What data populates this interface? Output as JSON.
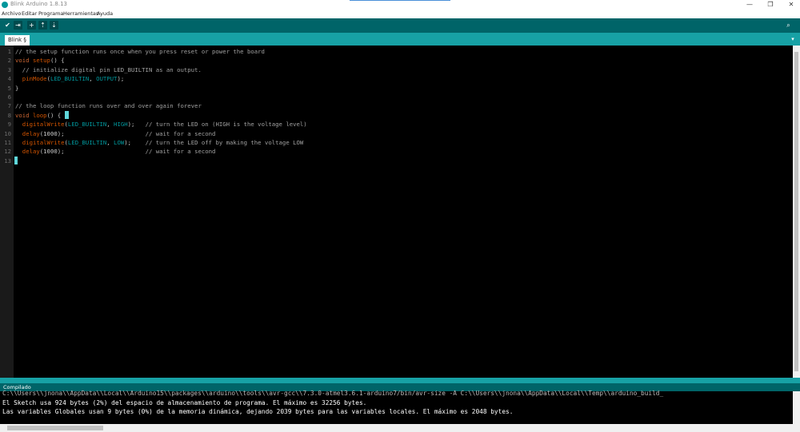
{
  "window": {
    "title": "Blink Arduino 1.8.13",
    "minimize": "—",
    "maximize": "❐",
    "close": "✕"
  },
  "menu": {
    "items": [
      "Archivo",
      "Editar",
      "Programa",
      "Herramientas",
      "Ayuda"
    ]
  },
  "toolbar": {
    "buttons": [
      {
        "name": "verify-button",
        "icon": "check-icon",
        "glyph": "✔"
      },
      {
        "name": "upload-button",
        "icon": "arrow-right-icon",
        "glyph": "⇥"
      },
      {
        "name": "new-button",
        "icon": "plus-icon",
        "glyph": "+"
      },
      {
        "name": "open-button",
        "icon": "arrow-up-icon",
        "glyph": "⇡"
      },
      {
        "name": "save-button",
        "icon": "arrow-down-icon",
        "glyph": "⇣"
      }
    ],
    "serial_monitor_glyph": "⌕"
  },
  "tabs": {
    "active": "Blink §",
    "menu_glyph": "▾"
  },
  "editor": {
    "lines": [
      {
        "n": "1",
        "html": "<span class='cm'>// the setup function runs once when you press reset or power the board</span>"
      },
      {
        "n": "2",
        "html": "<span class='kw'>void</span> <span class='fn'>setup</span>() {"
      },
      {
        "n": "3",
        "html": "  <span class='cm'>// initialize digital pin LED_BUILTIN as an output.</span>"
      },
      {
        "n": "4",
        "html": "  <span class='fn'>pinMode</span>(<span class='cn'>LED_BUILTIN</span>, <span class='cn'>OUTPUT</span>);"
      },
      {
        "n": "5",
        "html": "}"
      },
      {
        "n": "6",
        "html": ""
      },
      {
        "n": "7",
        "html": "<span class='cm'>// the loop function runs over and over again forever</span>"
      },
      {
        "n": "8",
        "html": "<span class='kw'>void</span> <span class='fn'>loop</span>() {"
      },
      {
        "n": "9",
        "html": "  <span class='fn'>digitalWrite</span>(<span class='cn'>LED_BUILTIN</span>, <span class='cn'>HIGH</span>);   <span class='cm'>// turn the LED on (HIGH is the voltage level)</span>"
      },
      {
        "n": "10",
        "html": "  <span class='fn'>delay</span>(1000);                       <span class='cm'>// wait for a second</span>"
      },
      {
        "n": "11",
        "html": "  <span class='fn'>digitalWrite</span>(<span class='cn'>LED_BUILTIN</span>, <span class='cn'>LOW</span>);    <span class='cm'>// turn the LED off by making the voltage LOW</span>"
      },
      {
        "n": "12",
        "html": "  <span class='fn'>delay</span>(1000);                       <span class='cm'>// wait for a second</span>"
      },
      {
        "n": "13",
        "html": ""
      }
    ]
  },
  "console": {
    "status": "Compilado",
    "lines": [
      "C:\\\\Users\\\\jnona\\\\AppData\\\\Local\\\\Arduino15\\\\packages\\\\arduino\\\\tools\\\\avr-gcc\\\\7.3.0-atmel3.6.1-arduino7/bin/avr-size -A C:\\\\Users\\\\jnona\\\\AppData\\\\Local\\\\Temp\\\\arduino_build_",
      "El Sketch usa 924 bytes (2%) del espacio de almacenamiento de programa. El máximo es 32256 bytes.",
      "Las variables Globales usan 9 bytes (0%) de la memoria dinámica, dejando 2039 bytes para las variables locales. El máximo es 2048 bytes."
    ]
  },
  "colors": {
    "toolbar": "#006468",
    "tabs": "#17a1a5",
    "accent": "#00979c"
  }
}
